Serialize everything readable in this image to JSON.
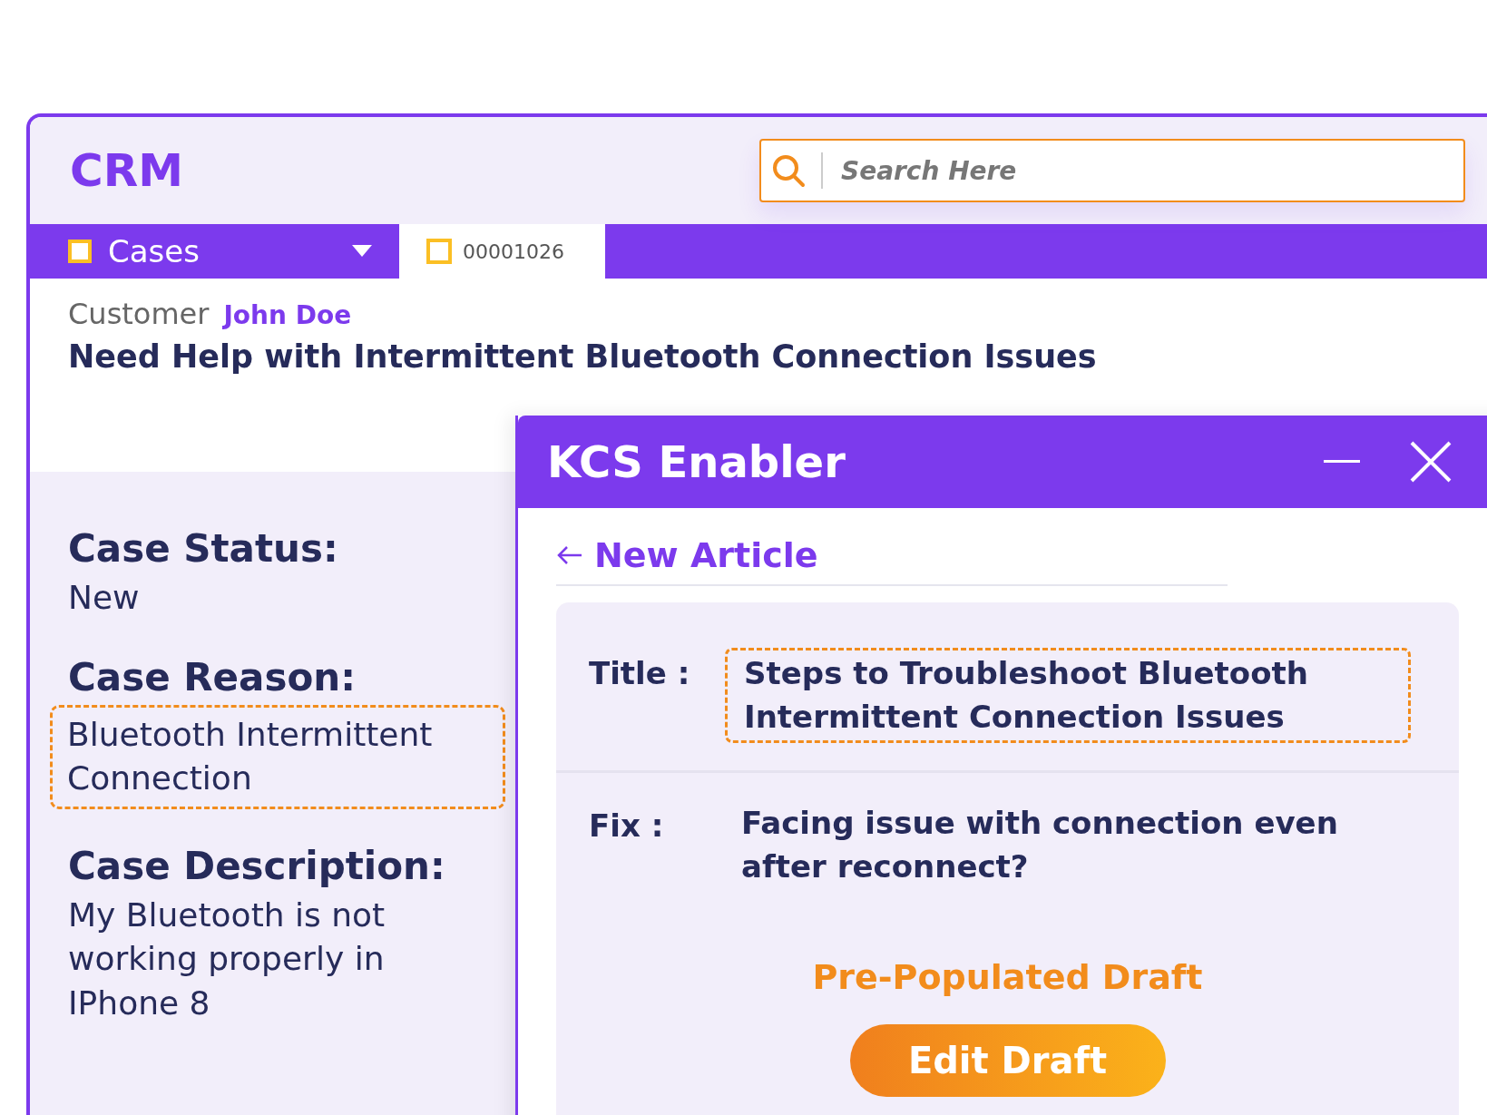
{
  "app": {
    "logo": "CRM"
  },
  "search": {
    "placeholder": "Search Here"
  },
  "nav": {
    "object_menu": "Cases",
    "tabs": [
      {
        "label": "00001026",
        "selected": true
      }
    ]
  },
  "record": {
    "customer_label": "Customer",
    "customer_name": "John Doe",
    "subject": "Need Help with Intermittent Bluetooth Connection Issues"
  },
  "details": [
    {
      "label": "Case Status:",
      "value": "New",
      "highlighted": false
    },
    {
      "label": "Case Reason:",
      "value": "Bluetooth Intermittent Connection",
      "highlighted": true
    },
    {
      "label": "Case Description:",
      "value": "My Bluetooth is not working properly in IPhone 8",
      "highlighted": false
    }
  ],
  "panel": {
    "title": "KCS Enabler",
    "back_link": "New Article",
    "fields": [
      {
        "label": "Title :",
        "value": "Steps to Troubleshoot Bluetooth Intermittent Connection Issues",
        "highlighted": true
      },
      {
        "label": "Fix :",
        "value": "Facing issue with connection even after reconnect?",
        "highlighted": false
      }
    ],
    "note": "Pre-Populated Draft",
    "button": "Edit Draft"
  }
}
